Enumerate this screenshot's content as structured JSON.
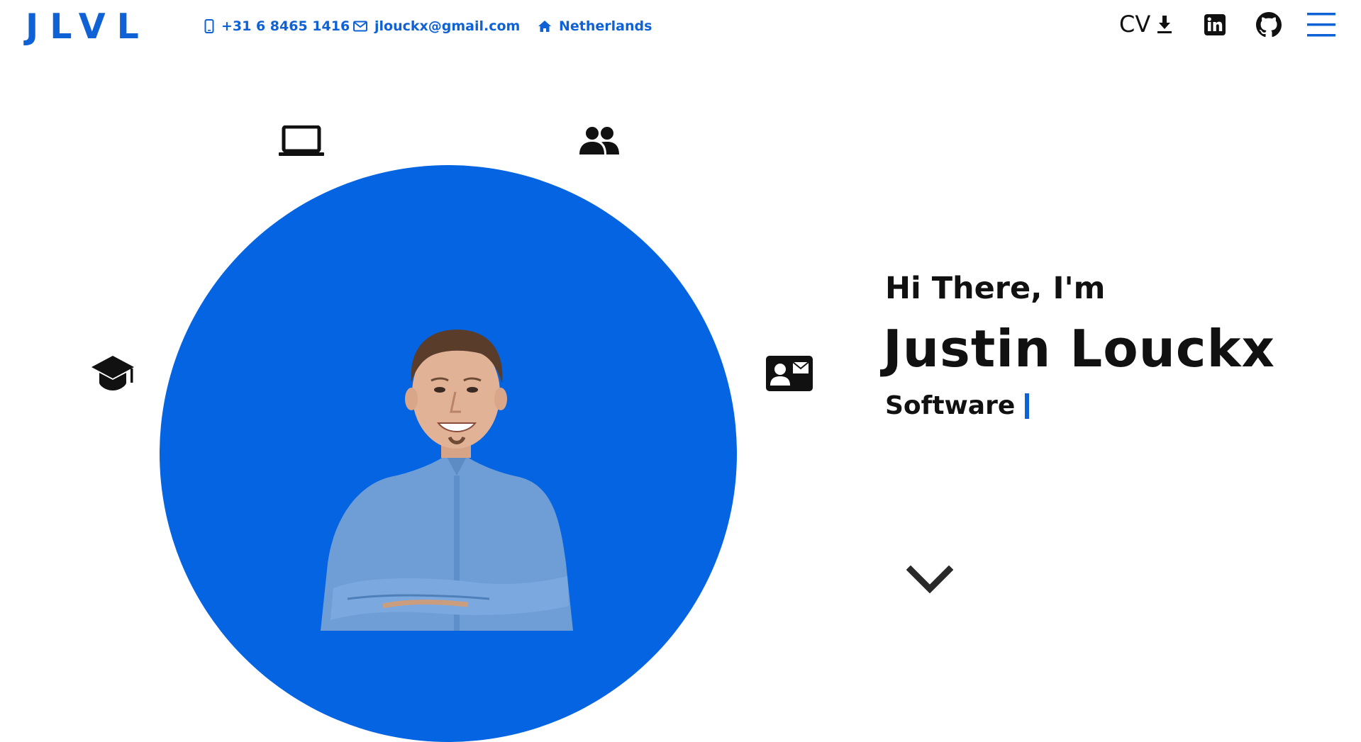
{
  "header": {
    "logo": "JLVL",
    "phone": "+31 6 8465 1416",
    "email": "jlouckx@gmail.com",
    "location": "Netherlands",
    "cv_label": "CV",
    "icons": {
      "phone": "mobile-phone-icon",
      "email": "envelope-icon",
      "location": "home-icon",
      "cv_download": "download-icon",
      "linkedin": "linkedin-icon",
      "github": "github-icon",
      "menu": "hamburger-menu-icon"
    }
  },
  "hero": {
    "greeting": "Hi There, I'm",
    "name": "Justin Louckx",
    "role": "Software",
    "orbit_icons": [
      "laptop-icon",
      "people-icon",
      "graduation-cap-icon",
      "contact-card-icon"
    ],
    "scroll_icon": "chevron-down-icon"
  },
  "colors": {
    "accent": "#0e62d6",
    "circle": "#0464e1",
    "text": "#111111",
    "background": "#ffffff"
  }
}
